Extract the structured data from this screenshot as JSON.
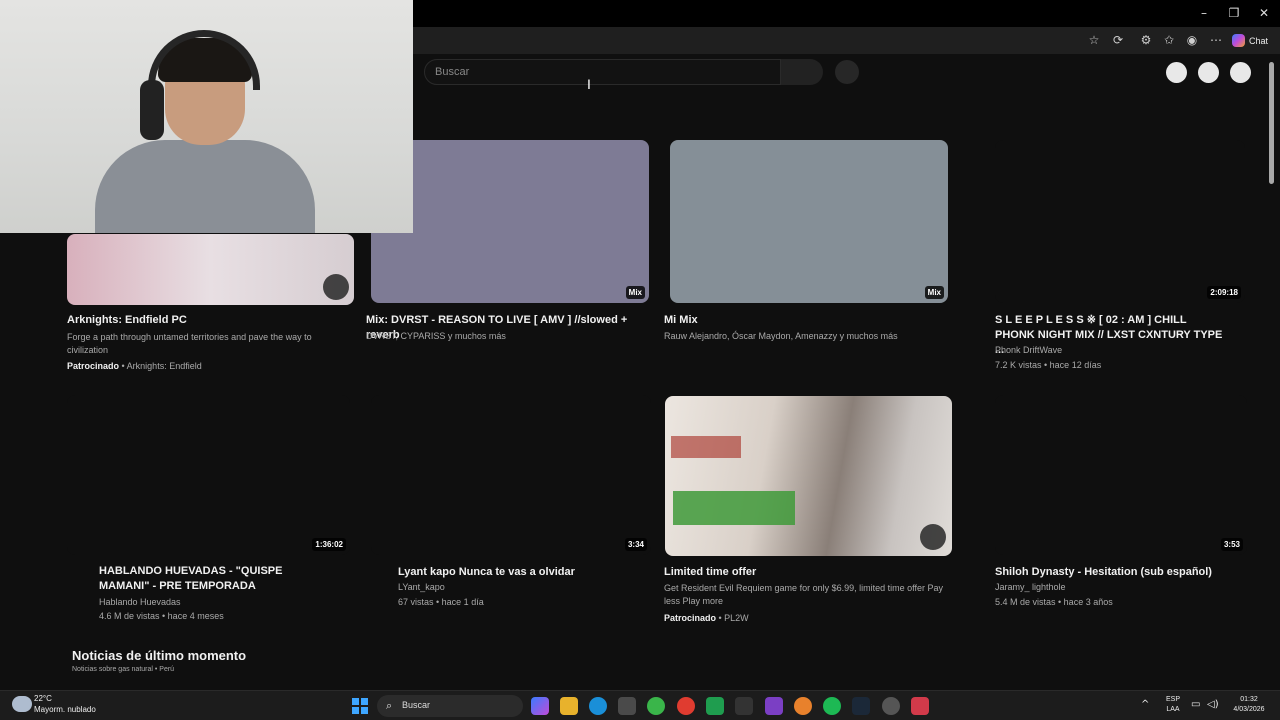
{
  "browser": {
    "chat_label": "Chat",
    "window_controls": [
      "minimize-icon",
      "restore-icon",
      "close-icon"
    ],
    "toolbar_icons": [
      "star-icon",
      "refresh-extension-icon",
      "extension-icon",
      "favorites-icon",
      "profile-icon",
      "more-icon"
    ]
  },
  "youtube": {
    "search_placeholder": "Buscar",
    "videos": [
      {
        "title": "Arknights: Endfield PC",
        "desc": "Forge a path through untamed territories and pave the way to civilization",
        "sponsored": "Patrocinado",
        "channel": "Arknights: Endfield",
        "thumb_color": "#c9a6b0"
      },
      {
        "title": "Mix: DVRST - REASON TO LIVE [ AMV ] //slowed + reverb",
        "channel": "DVRST, CYPARISS y muchos más",
        "badge": "Mix",
        "thumb_color": "#7e7b95"
      },
      {
        "title": "Mi Mix",
        "channel": "Rauw Alejandro, Óscar Maydon, Amenazzy y muchos más",
        "badge": "Mix",
        "thumb_color": "#858f97"
      },
      {
        "title": "S L E E P L E S S ※ [ 02 : AM ] CHILL PHONK NIGHT MIX // LXST CXNTURY TYPE ...",
        "channel": "Phonk DriftWave",
        "stats": "7.2 K vistas • hace 12 días",
        "duration": "2:09:18"
      },
      {
        "title": "HABLANDO HUEVADAS - \"QUISPE MAMANI\" - PRE TEMPORADA",
        "channel": "Hablando Huevadas",
        "stats": "4.6 M de vistas • hace 4 meses",
        "duration": "1:36:02"
      },
      {
        "title": "Lyant kapo Nunca te vas a olvidar",
        "channel": "LYant_kapo",
        "stats": "67 vistas • hace 1 día",
        "duration": "3:34"
      },
      {
        "title": "Limited time offer",
        "desc": "Get Resident Evil Requiem game for only $6.99, limited time offer Pay less Play more",
        "sponsored": "Patrocinado",
        "channel": "PL2W",
        "thumb_color": "#9a8f88"
      },
      {
        "title": "Shiloh Dynasty - Hesitation (sub español)",
        "channel": "Jaramy_ lighthole",
        "stats": "5.4 M de vistas • hace 3 años",
        "duration": "3:53"
      }
    ],
    "news_title": "Noticias de último momento",
    "news_subtitle": "Noticias sobre gas natural • Perú"
  },
  "taskbar": {
    "temperature": "22°C",
    "condition": "Mayorm. nublado",
    "search_label": "Buscar",
    "lang_top": "ESP",
    "lang_bottom": "LAA",
    "time": "01:32",
    "date": "4/03/2026"
  }
}
